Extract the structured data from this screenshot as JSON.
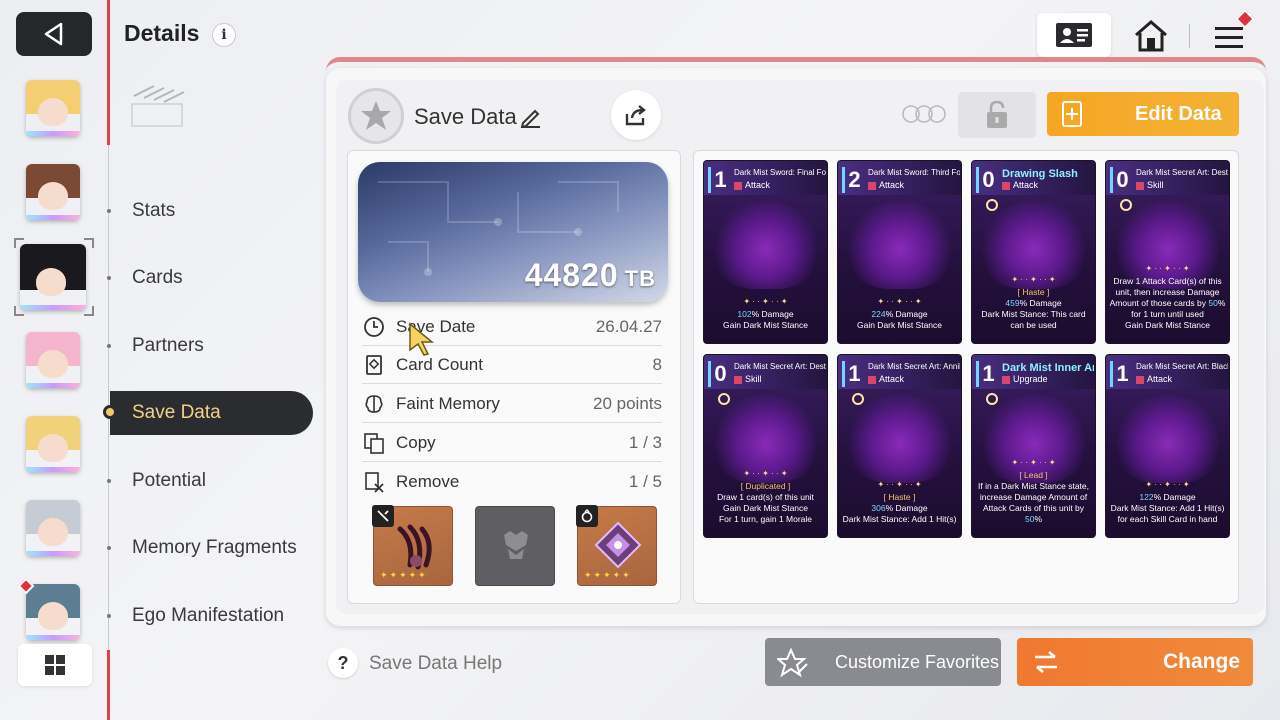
{
  "header": {
    "title": "Details",
    "info_icon": "i"
  },
  "nav": {
    "items": [
      "Stats",
      "Cards",
      "Partners",
      "Save Data",
      "Potential",
      "Memory Fragments",
      "Ego Manifestation"
    ],
    "active": "Save Data"
  },
  "save": {
    "title": "Save Data",
    "edit_label": "Edit Data",
    "tb_value": "44820",
    "tb_unit": "TB",
    "rows": [
      {
        "label": "Save Date",
        "value": "26.04.27",
        "icon": "clock-icon"
      },
      {
        "label": "Card Count",
        "value": "8",
        "icon": "card-icon"
      },
      {
        "label": "Faint Memory",
        "value": "20 points",
        "icon": "brain-icon"
      },
      {
        "label": "Copy",
        "value": "1 / 3",
        "icon": "copy-icon"
      },
      {
        "label": "Remove",
        "value": "1 / 5",
        "icon": "remove-icon"
      }
    ]
  },
  "cards": [
    {
      "cost": "1",
      "name": "Dark Mist Sword: Final Form",
      "type": "Attack",
      "lines": [
        "<span class='hl'>102</span>% Damage",
        "Gain Dark Mist Stance"
      ]
    },
    {
      "cost": "2",
      "name": "Dark Mist Sword: Third Form",
      "type": "Attack",
      "lines": [
        "<span class='hl'>224</span>% Damage",
        "Gain Dark Mist Stance"
      ]
    },
    {
      "cost": "0",
      "name": "Drawing Slash",
      "big": true,
      "type": "Attack",
      "lines": [
        "<span class='kw'>[ Haste ]</span>",
        "<span class='hl'>459</span>% Damage",
        "Dark Mist Stance: This card can be used"
      ]
    },
    {
      "cost": "0",
      "name": "Dark Mist Secret Art: Destruction",
      "type": "Skill",
      "lines": [
        "Draw 1 Attack Card(s) of this unit, then increase Damage Amount of those cards by <span class='hl'>50</span>% for 1 turn until used",
        "Gain Dark Mist Stance"
      ]
    },
    {
      "cost": "0",
      "name": "Dark Mist Secret Art: Destruction",
      "type": "Skill",
      "lines": [
        "<span class='kw'>[ Duplicated ]</span>",
        "Draw 1 card(s) of this unit",
        "Gain Dark Mist Stance",
        "For 1 turn, gain 1 Morale"
      ]
    },
    {
      "cost": "1",
      "name": "Dark Mist Secret Art: Annihilation",
      "type": "Attack",
      "lines": [
        "<span class='kw'>[ Haste ]</span>",
        "<span class='hl'>306</span>% Damage",
        "Dark Mist Stance: Add 1 Hit(s)"
      ]
    },
    {
      "cost": "1",
      "name": "Dark Mist Inner Art",
      "big": true,
      "type": "Upgrade",
      "lines": [
        "<span class='kw'>[ Lead ]</span>",
        "If in a Dark Mist Stance state, increase Damage Amount of Attack Cards of this unit by <span class='hl'>50</span>%"
      ]
    },
    {
      "cost": "1",
      "name": "Dark Mist Secret Art: Black Dance",
      "type": "Attack",
      "lines": [
        "<span class='hl'>122</span>% Damage",
        "Dark Mist Stance: Add 1 Hit(s) for each Skill Card in hand"
      ]
    }
  ],
  "bottom": {
    "help_label": "Save Data Help",
    "favorites_label": "Customize Favorites",
    "change_label": "Change"
  },
  "colors": {
    "accent_orange": "#f07830",
    "edit_orange": "#f5a623",
    "nav_active_text": "#f3d089",
    "divider_red": "#d9434b"
  }
}
